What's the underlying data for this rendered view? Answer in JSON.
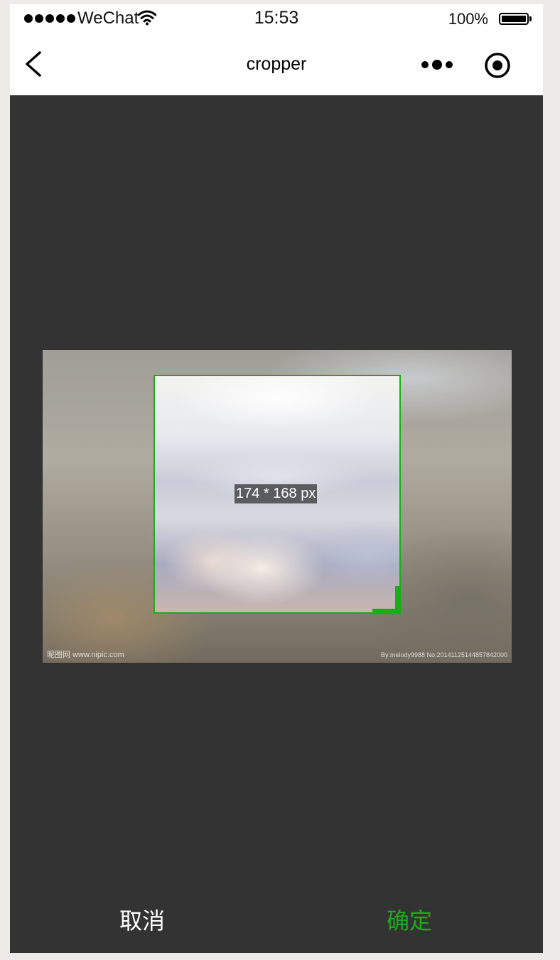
{
  "status_bar": {
    "carrier": "WeChat",
    "time": "15:53",
    "battery_percent": "100%",
    "signal_icon": "signal-dots-icon",
    "wifi_icon": "wifi-icon",
    "battery_icon": "battery-full-icon"
  },
  "nav_bar": {
    "title": "cropper",
    "back_icon": "chevron-left-icon",
    "menu_icon": "more-dots-icon",
    "close_icon": "target-close-icon"
  },
  "cropper": {
    "size_label": "174 * 168 px",
    "watermark_left": "昵图网 www.nipic.com",
    "watermark_right": "By:melody9988 No:20141125144857842000",
    "frame_color": "#1aad19"
  },
  "actions": {
    "cancel_label": "取消",
    "confirm_label": "确定"
  },
  "colors": {
    "background": "#333333",
    "accent": "#1aad19"
  }
}
